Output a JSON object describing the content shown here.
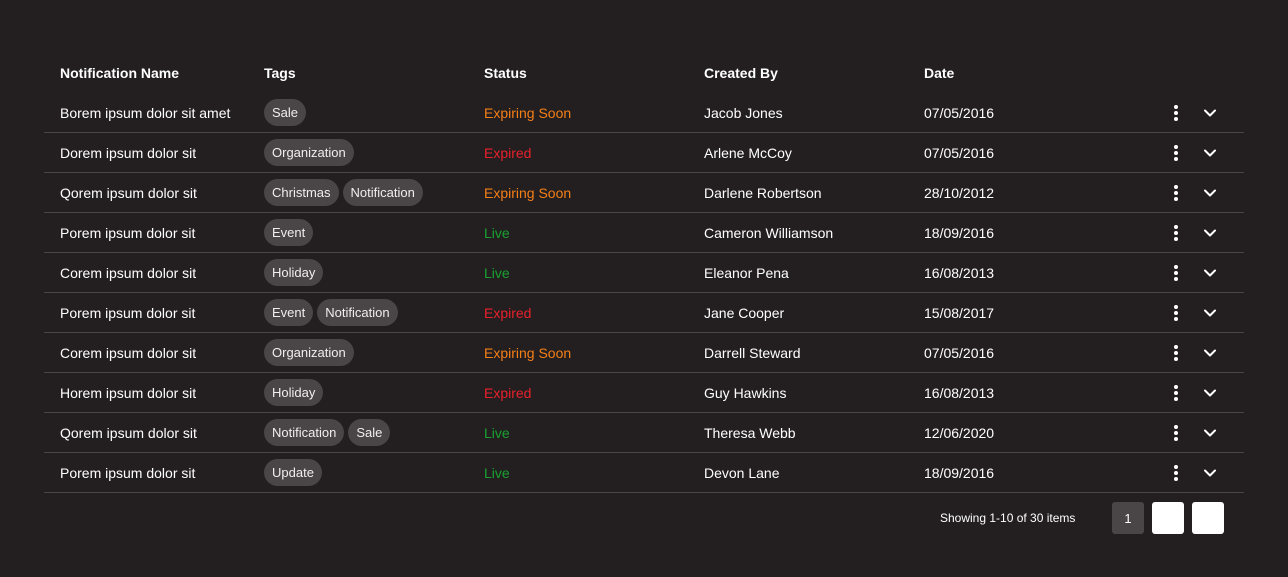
{
  "table": {
    "headers": {
      "name": "Notification Name",
      "tags": "Tags",
      "status": "Status",
      "created_by": "Created By",
      "date": "Date"
    },
    "rows": [
      {
        "name": "Borem ipsum dolor sit amet",
        "tags": [
          "Sale"
        ],
        "status": "Expiring Soon",
        "status_type": "expiring",
        "created_by": "Jacob Jones",
        "date": "07/05/2016"
      },
      {
        "name": "Dorem ipsum dolor sit",
        "tags": [
          "Organization"
        ],
        "status": "Expired",
        "status_type": "expired",
        "created_by": "Arlene McCoy",
        "date": "07/05/2016"
      },
      {
        "name": "Qorem ipsum dolor sit",
        "tags": [
          "Christmas",
          "Notification"
        ],
        "status": "Expiring Soon",
        "status_type": "expiring",
        "created_by": "Darlene Robertson",
        "date": "28/10/2012"
      },
      {
        "name": "Porem ipsum dolor sit",
        "tags": [
          "Event"
        ],
        "status": "Live",
        "status_type": "live",
        "created_by": "Cameron Williamson",
        "date": "18/09/2016"
      },
      {
        "name": "Corem ipsum dolor sit",
        "tags": [
          "Holiday"
        ],
        "status": "Live",
        "status_type": "live",
        "created_by": "Eleanor Pena",
        "date": "16/08/2013"
      },
      {
        "name": "Porem ipsum dolor sit",
        "tags": [
          "Event",
          "Notification"
        ],
        "status": "Expired",
        "status_type": "expired",
        "created_by": "Jane Cooper",
        "date": "15/08/2017"
      },
      {
        "name": "Corem ipsum dolor sit",
        "tags": [
          "Organization"
        ],
        "status": "Expiring Soon",
        "status_type": "expiring",
        "created_by": "Darrell Steward",
        "date": "07/05/2016"
      },
      {
        "name": "Horem ipsum dolor sit",
        "tags": [
          "Holiday"
        ],
        "status": "Expired",
        "status_type": "expired",
        "created_by": "Guy Hawkins",
        "date": "16/08/2013"
      },
      {
        "name": "Qorem ipsum dolor sit",
        "tags": [
          "Notification",
          "Sale"
        ],
        "status": "Live",
        "status_type": "live",
        "created_by": "Theresa Webb",
        "date": "12/06/2020"
      },
      {
        "name": "Porem ipsum dolor sit",
        "tags": [
          "Update"
        ],
        "status": "Live",
        "status_type": "live",
        "created_by": "Devon Lane",
        "date": "18/09/2016"
      }
    ],
    "row_actions": {
      "more_icon": "more-vertical-icon",
      "expand_icon": "chevron-down-icon"
    }
  },
  "pagination": {
    "showing_text": "Showing 1-10 of 30 items",
    "pages": [
      "1",
      "",
      ""
    ],
    "current_page": "1"
  },
  "colors": {
    "background": "#231f20",
    "tag_background": "#4a4546",
    "status_live": "#18a030",
    "status_expired": "#e8212b",
    "status_expiring": "#f57f17",
    "divider": "#4a4547"
  }
}
